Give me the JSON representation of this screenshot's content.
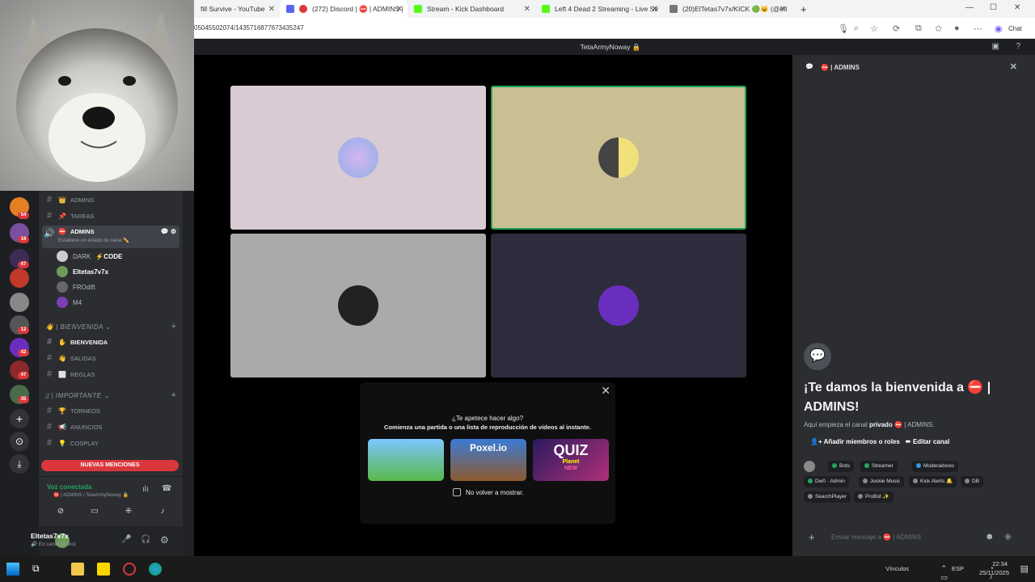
{
  "browser": {
    "tabs": [
      {
        "label": "fill Survive - YouTube"
      },
      {
        "label": "(272) Discord | ⛔ | ADMINS |"
      },
      {
        "label": "Stream - Kick Dashboard"
      },
      {
        "label": "Left 4 Dead 2 Streaming - Live Str"
      },
      {
        "label": "(20)ElTetas7v7x/KICK 🟢😺 (@elt"
      }
    ],
    "url": "05045502074/1435716877673435247",
    "chat_label": "Chat"
  },
  "server": {
    "title": "TetaArmyNoway 🔒"
  },
  "guild_badges": [
    "54",
    "16",
    "47",
    "12",
    "42",
    "47",
    "35"
  ],
  "channels": [
    {
      "emoji": "👑",
      "label": "ADMINS"
    },
    {
      "emoji": "📌",
      "label": "TAREAS"
    },
    {
      "emoji": "⛔",
      "label": "ADMINS",
      "status": "Establece un estado de canal ✏️"
    }
  ],
  "voice_users": [
    {
      "name": "DARK",
      "tag": "⚡CODE"
    },
    {
      "name": "Eltetas7v7x"
    },
    {
      "name": "FROdift"
    },
    {
      "name": "M4"
    }
  ],
  "categories": [
    {
      "label": "👋 | BIENVENIDA ⌄",
      "channels": [
        {
          "emoji": "✋",
          "label": "BIENVENIDA"
        },
        {
          "emoji": "👋",
          "label": "SALIDAS"
        },
        {
          "emoji": "⬜",
          "label": "REGLAS"
        }
      ]
    },
    {
      "label": "▯ | IMPORTANTE ⌄",
      "channels": [
        {
          "emoji": "🏆",
          "label": "TORNEOS"
        },
        {
          "emoji": "📢",
          "label": "ANUNCIOS"
        },
        {
          "emoji": "💡",
          "label": "COSPLAY"
        }
      ]
    }
  ],
  "mentions_label": "NUEVAS MENCIONES",
  "voice_panel": {
    "status": "Voz conectada",
    "channel": "⛔ | ADMINS / TetaArmyNoway 🔒"
  },
  "user_panel": {
    "name": "Eltetas7v7x",
    "status": "🔊 En canal de voz"
  },
  "activity": {
    "title": "¿Te apetece hacer algo?",
    "subtitle": "Comienza una partida o una lista de reproducción de vídeos al instante.",
    "games": [
      "",
      "Poxel.io",
      "QUIZ"
    ],
    "game_sub": "Planet",
    "game_badge": "NEW",
    "checkbox": "No volver a mostrar."
  },
  "chat": {
    "channel": "⛔ | ADMINS",
    "welcome_title": "¡Te damos la bienvenida a ⛔ | ADMINS!",
    "welcome_pre": "Aquí empieza el canal ",
    "welcome_bold": "privado",
    "welcome_post": " ⛔ | ADMINS.",
    "add_members": "Añadir miembros o roles",
    "edit_channel": "Editar canal",
    "roles_row1": [
      "Bots",
      "Streamer",
      "Moderadores"
    ],
    "roles_row2": [
      "Dw0 · Admin",
      "Jockie Music",
      "Kick Alerts 🔔",
      "DB"
    ],
    "roles_row3": [
      "SearchPlayer",
      "ProBot ✨"
    ],
    "composer": "Enviar mensaje a ⛔ | ADMINS"
  },
  "taskbar": {
    "tray_label": "Vínculos",
    "lang": "ESP",
    "time": "22:34",
    "date": "25/11/2025"
  }
}
